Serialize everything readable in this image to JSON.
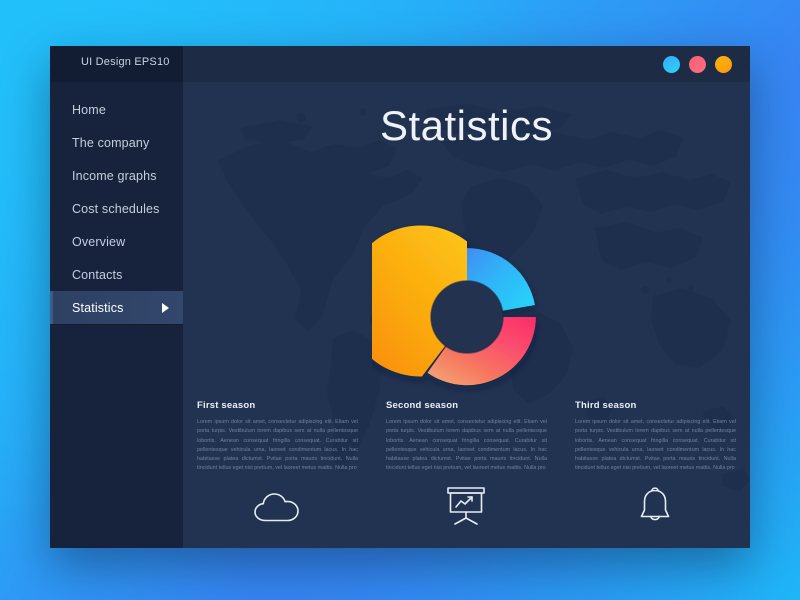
{
  "window": {
    "app_title": "UI Design EPS10",
    "controls": [
      {
        "name": "window-dot-blue",
        "color": "#2ecdfa"
      },
      {
        "name": "window-dot-pink",
        "color": "#fa6476"
      },
      {
        "name": "window-dot-orange",
        "color": "#faa70a"
      }
    ]
  },
  "sidebar": {
    "items": [
      {
        "label": "Home",
        "active": false
      },
      {
        "label": "The company",
        "active": false
      },
      {
        "label": "Income graphs",
        "active": false
      },
      {
        "label": "Cost schedules",
        "active": false
      },
      {
        "label": "Overview",
        "active": false
      },
      {
        "label": "Contacts",
        "active": false
      },
      {
        "label": "Statistics",
        "active": true
      }
    ],
    "active_arrow_icon": "play-triangle-icon"
  },
  "main": {
    "title": "Statistics",
    "background_icon": "world-map-icon"
  },
  "chart_data": {
    "type": "pie",
    "variant": "donut",
    "title": "Statistics",
    "legend_position": "none",
    "labels": [
      "First season",
      "Second season",
      "Third season"
    ],
    "values": [
      45,
      22,
      33
    ],
    "units": "%",
    "start_angle_deg": 0,
    "segments": [
      {
        "label": "First season",
        "value": 45,
        "start_deg": 215,
        "end_deg": 360,
        "color_from": "#fcc216",
        "color_to": "#f98c09",
        "exploded": true
      },
      {
        "label": "Second season",
        "value": 22,
        "start_deg": 0,
        "end_deg": 80,
        "color_from": "#3f8ef4",
        "color_to": "#27d7fb",
        "exploded": false
      },
      {
        "label": "Third season",
        "value": 33,
        "start_deg": 80,
        "end_deg": 215,
        "color_from": "#fb3a6b",
        "color_to": "#f59266",
        "exploded": false
      }
    ],
    "inner_radius_ratio": 0.52,
    "grid": false
  },
  "columns": [
    {
      "title": "First season",
      "body": "Lorem ipsum dolor sit amet, consectetur adipiscing elit. Etiam vel porta turpis. Vestibulum lorem dapibus sem at nulla pellentesque lobortis. Aenean consequat fringilla consequat. Curabitur sit pellentesque vehicula urna, laoreet condimentum lacus. In hac habitasse platea dictumst. Pvitae porta mauris tincidunt. Nulla tincidunt tellus eget nisi pretium, vel laoreet metus mattis. Nulla pro",
      "icon": "cloud-icon"
    },
    {
      "title": "Second season",
      "body": "Lorem ipsum dolor sit amet, consectetur adipiscing elit. Etiam vel porta turpis. Vestibulum lorem dapibus sem at nulla pellentesque lobortis. Aenean consequat fringilla consequat. Curabitur sit pellentesque vehicula urna, laoreet condimentum lacus. In hac habitasse platea dictumst. Pvitae porta mauris tincidunt. Nulla tincidunt tellus eget nisi pretium, vel laoreet metus mattis. Nulla pro",
      "icon": "presentation-chart-icon"
    },
    {
      "title": "Third season",
      "body": "Lorem ipsum dolor sit amet, consectetur adipiscing elit. Etiam vel porta turpis. Vestibulum lorem dapibus sem at nulla pellentesque lobortis. Aenean consequat fringilla consequat. Curabitur sit pellentesque vehicula urna, laoreet condimentum lacus. In hac habitasse platea dictumst. Pvitae porta mauris tincidunt. Nulla tincidunt tellus eget nisi pretium, vel laoreet metus mattis. Nulla pro",
      "icon": "bell-icon"
    }
  ],
  "colors": {
    "page_gradient_from": "#24bdfb",
    "page_gradient_to": "#4068ef",
    "window_bg": "#223352",
    "sidebar_bg": "#17233c",
    "titlebar_bg": "#1d2b45",
    "accent_orange": "#f9a40b",
    "accent_blue": "#2ecdfa",
    "accent_pink": "#fa4a6e"
  }
}
